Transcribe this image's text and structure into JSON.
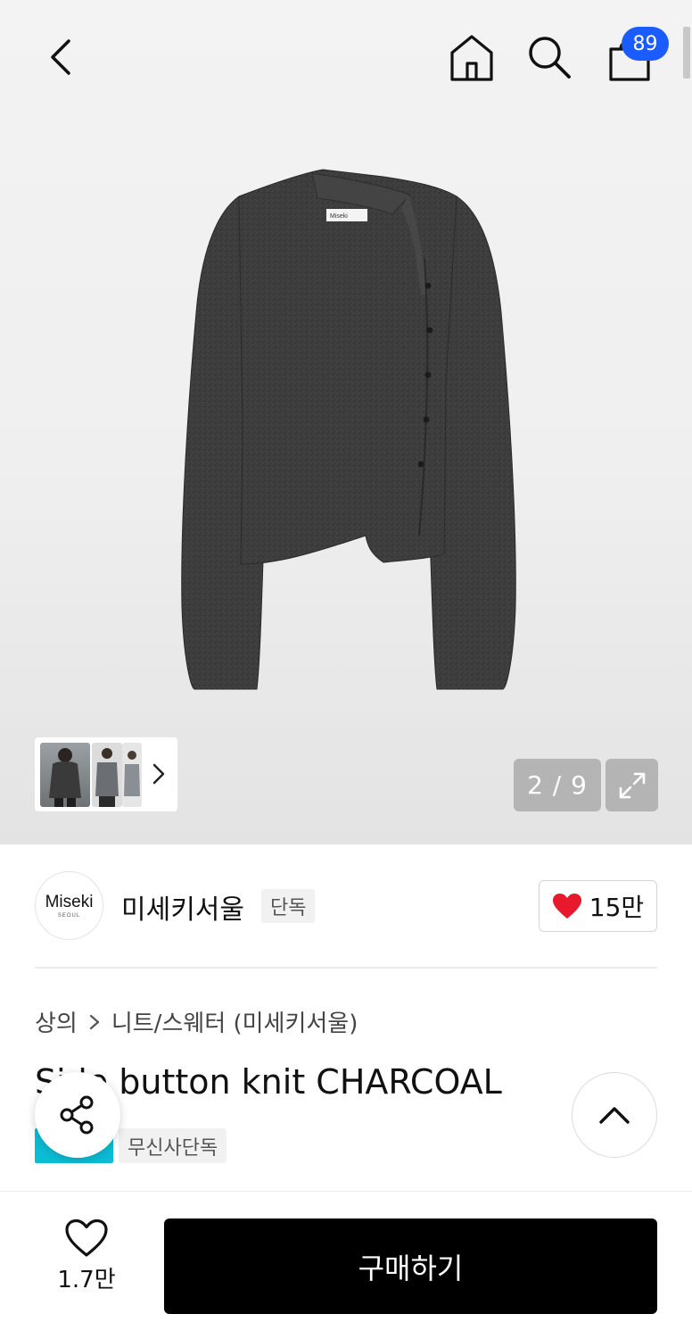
{
  "header": {
    "cart_count": "89"
  },
  "gallery": {
    "counter": "2 / 9",
    "product_brand_tag": "Miseki"
  },
  "brand": {
    "logo_main": "Miseki",
    "logo_sub": "SEOUL",
    "name": "미세키서울",
    "tag": "단독",
    "like_count": "15만"
  },
  "breadcrumb": {
    "category": "상의",
    "subcategory": "니트/스웨터 (미세키서울)"
  },
  "product": {
    "title": "Side button knit CHARCOAL",
    "badge_exclusive": "무신사단독"
  },
  "bottom_bar": {
    "wish_count": "1.7만",
    "buy_label": "구매하기"
  },
  "icons": {
    "back": "chevron-left",
    "home": "home",
    "search": "magnifier",
    "cart": "shopping-bag",
    "expand": "expand-arrows",
    "share": "share-nodes",
    "scroll_top": "chevron-up",
    "wish": "heart-outline",
    "brand_like": "heart-filled"
  },
  "colors": {
    "cart_badge": "#1a5cff",
    "brand_like_heart": "#e8192c",
    "badge_exclusive": "#0bbcd6",
    "buy_button": "#000000"
  }
}
